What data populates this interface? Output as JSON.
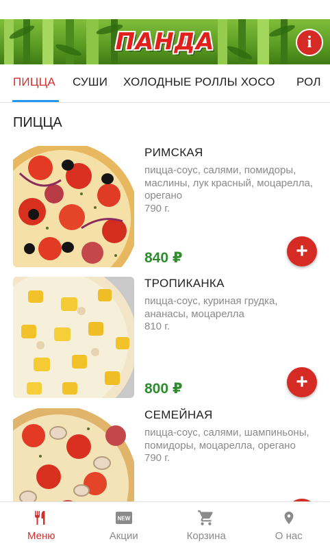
{
  "header": {
    "logo_text": "ПАНДА",
    "info_icon": "info-icon"
  },
  "tabs": [
    {
      "label": "ПИЦЦА",
      "active": true
    },
    {
      "label": "СУШИ",
      "active": false
    },
    {
      "label": "ХОЛОДНЫЕ РОЛЛЫ ХОСО",
      "active": false
    },
    {
      "label": "РОЛ",
      "active": false
    }
  ],
  "section": {
    "title": "ПИЦЦА"
  },
  "products": [
    {
      "name": "РИМСКАЯ",
      "description": "пицца-соус, салями, помидоры, маслины, лук красный, моцарелла, орегано",
      "weight": "790 г.",
      "price": "840 ₽"
    },
    {
      "name": "ТРОПИКАНКА",
      "description": "пицца-соус, куриная грудка, ананасы, моцарелла",
      "weight": "810 г.",
      "price": "800 ₽"
    },
    {
      "name": "СЕМЕЙНАЯ",
      "description": "пицца-соус, салями, шампиньоны, помидоры, моцарелла, орегано",
      "weight": "790 г.",
      "price": ""
    }
  ],
  "nav": [
    {
      "label": "Меню",
      "icon": "fork-knife-icon",
      "active": true
    },
    {
      "label": "Акции",
      "icon": "new-badge-icon",
      "active": false
    },
    {
      "label": "Корзина",
      "icon": "cart-icon",
      "active": false
    },
    {
      "label": "О нас",
      "icon": "location-pin-icon",
      "active": false
    }
  ],
  "colors": {
    "accent": "#d32f2f",
    "price": "#2e8b2e",
    "tab_indicator": "#2196f3",
    "add_button": "#d52b24",
    "header_green": "#5a9a22"
  }
}
